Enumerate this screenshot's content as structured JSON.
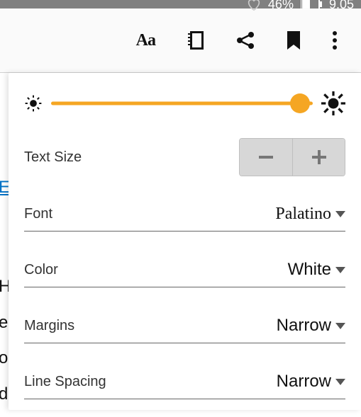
{
  "status": {
    "battery_percent": "46%",
    "time": "9.05"
  },
  "toolbar": {
    "aa_label": "Aa"
  },
  "panel": {
    "brightness_percent": 95,
    "text_size_label": "Text Size",
    "rows": {
      "font": {
        "label": "Font",
        "value": "Palatino"
      },
      "color": {
        "label": "Color",
        "value": "White"
      },
      "margins": {
        "label": "Margins",
        "value": "Narrow"
      },
      "line_spacing": {
        "label": "Line Spacing",
        "value": "Narrow"
      }
    }
  },
  "background_text": {
    "line1": "E",
    "line2": "H",
    "line3": "e",
    "line4": "o",
    "line5": "d"
  },
  "colors": {
    "accent": "#f5a623",
    "toolbar_bg": "#fafafa",
    "statusbar_bg": "#808080"
  },
  "icons": {
    "heart": "heart-icon",
    "battery": "battery-icon",
    "notebook": "notebook-icon",
    "share": "share-icon",
    "bookmark": "bookmark-icon",
    "overflow": "overflow-icon",
    "sun_low": "brightness-low-icon",
    "sun_high": "brightness-high-icon",
    "minus": "minus-icon",
    "plus": "plus-icon",
    "caret": "chevron-down-icon"
  }
}
